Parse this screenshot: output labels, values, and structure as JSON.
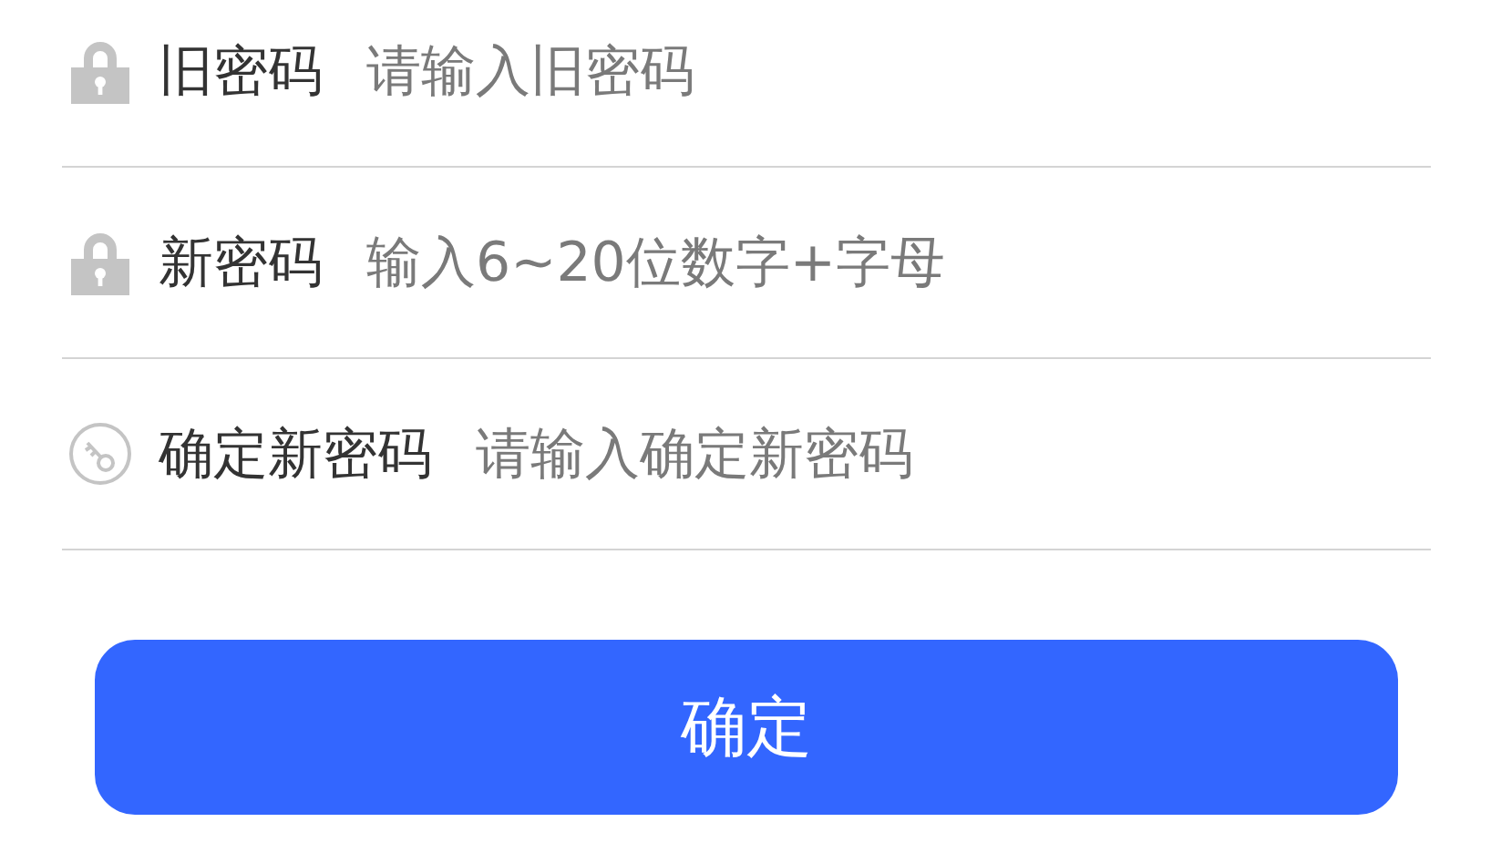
{
  "fields": [
    {
      "kind": "lock",
      "label": "旧密码",
      "placeholder": "请输入旧密码"
    },
    {
      "kind": "lock",
      "label": "新密码",
      "placeholder": "输入6~20位数字+字母"
    },
    {
      "kind": "key",
      "label": "确定新密码",
      "placeholder": "请输入确定新密码"
    }
  ],
  "submit": {
    "label": "确定"
  }
}
